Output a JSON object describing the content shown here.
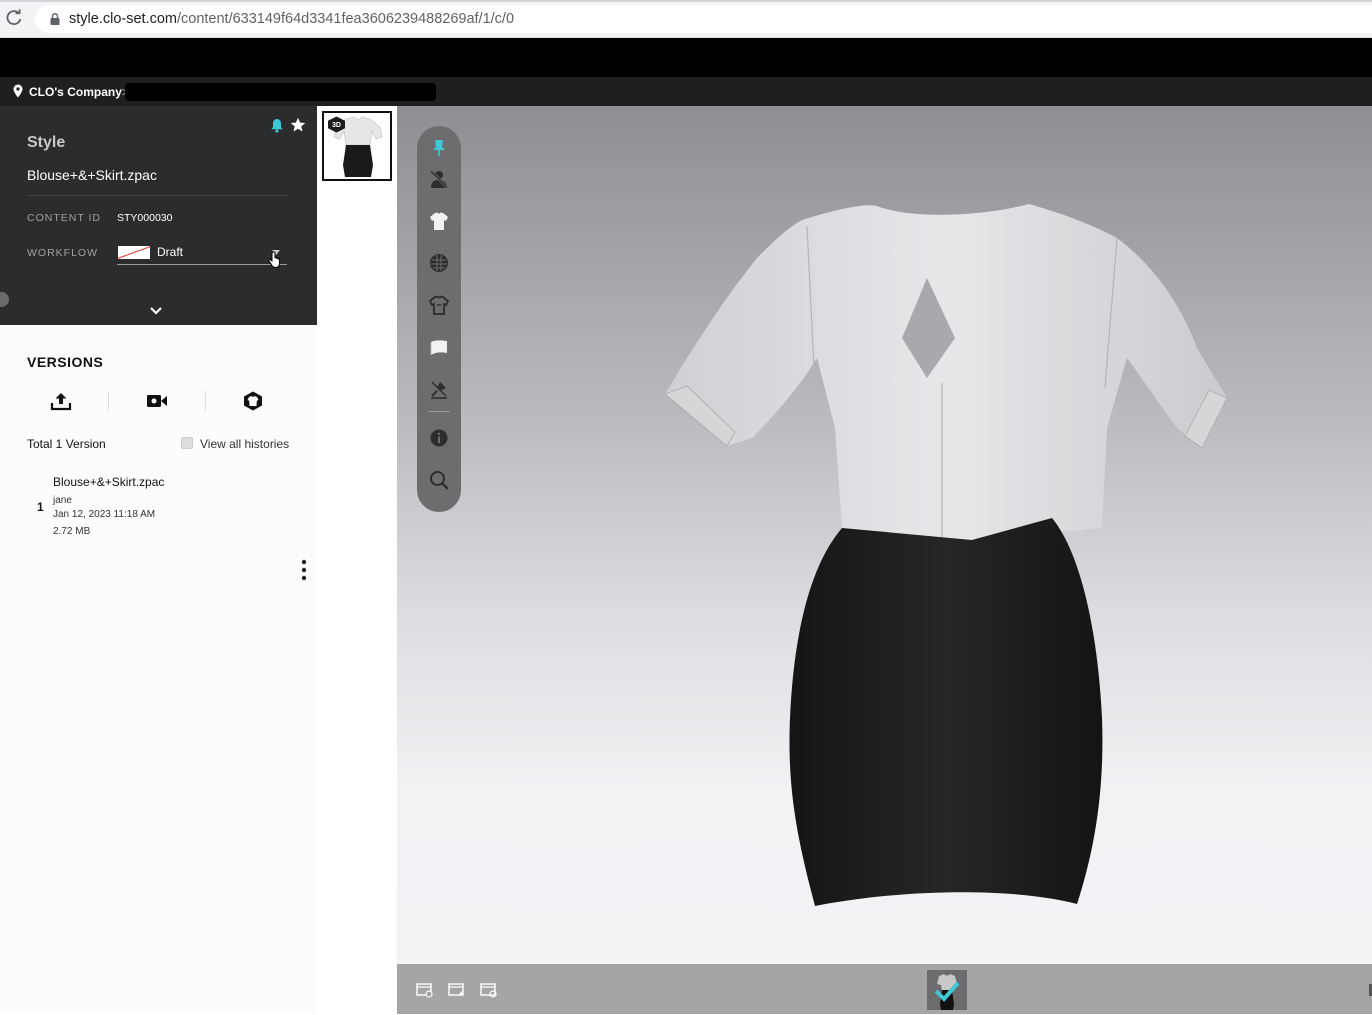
{
  "browser": {
    "url_host": "style.clo-set.com",
    "url_path": "/content/633149f64d3341fea3606239488269af/1/c/0"
  },
  "breadcrumb": {
    "company": "CLO's Company",
    "separator": ">"
  },
  "info": {
    "style_label": "Style",
    "style_name": "Blouse+&+Skirt.zpac",
    "content_id_label": "CONTENT ID",
    "content_id_value": "STY000030",
    "workflow_label": "WORKFLOW",
    "workflow_value": "Draft"
  },
  "versions": {
    "title": "VERSIONS",
    "total_label": "Total 1 Version",
    "view_all_label": "View all histories",
    "items": [
      {
        "number": "1",
        "file": "Blouse+&+Skirt.zpac",
        "user": "jane",
        "date": "Jan 12, 2023 11:18 AM",
        "size": "2.72 MB"
      }
    ]
  },
  "thumbnail": {
    "badge": "3D"
  },
  "toolbar": {
    "icons": [
      "pin-icon",
      "avatar-hide-icon",
      "garment-icon",
      "texture-icon",
      "fitting-icon",
      "fabric-icon",
      "no-pin-icon",
      "info-icon",
      "zoom-icon"
    ]
  },
  "colors": {
    "accent": "#3fc7d6",
    "panel_dark": "#2b2c2e",
    "toolbar": "#6d6d70"
  }
}
